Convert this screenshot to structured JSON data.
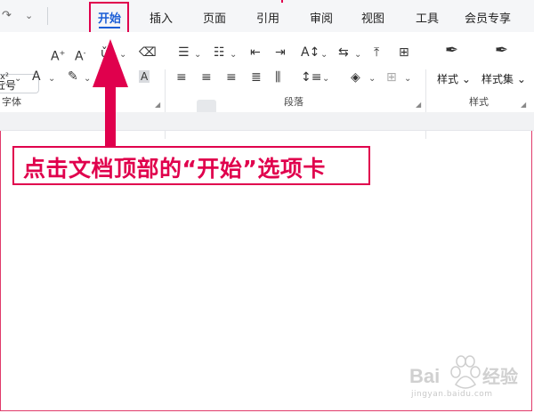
{
  "tabs": [
    {
      "id": "start",
      "label": "开始",
      "active": true
    },
    {
      "id": "insert",
      "label": "插入"
    },
    {
      "id": "page",
      "label": "页面"
    },
    {
      "id": "reference",
      "label": "引用"
    },
    {
      "id": "review",
      "label": "审阅"
    },
    {
      "id": "view",
      "label": "视图"
    },
    {
      "id": "tools",
      "label": "工具"
    },
    {
      "id": "member",
      "label": "会员专享"
    }
  ],
  "font_size_field": {
    "value": "五号"
  },
  "groups": {
    "font": {
      "label": "字体"
    },
    "paragraph": {
      "label": "段落"
    },
    "styles": {
      "label": "样式"
    }
  },
  "styles_buttons": {
    "style": "样式",
    "style_set": "样式集"
  },
  "font_buttons": {
    "superscript": "x²",
    "highlight_A": "A"
  },
  "annotation": {
    "caption": "点击文档顶部的“开始”选项卡"
  },
  "watermark": {
    "text": "jingyan.baidu.com"
  },
  "colors": {
    "accent": "#1b5ed6",
    "annotation": "#e0004d"
  }
}
